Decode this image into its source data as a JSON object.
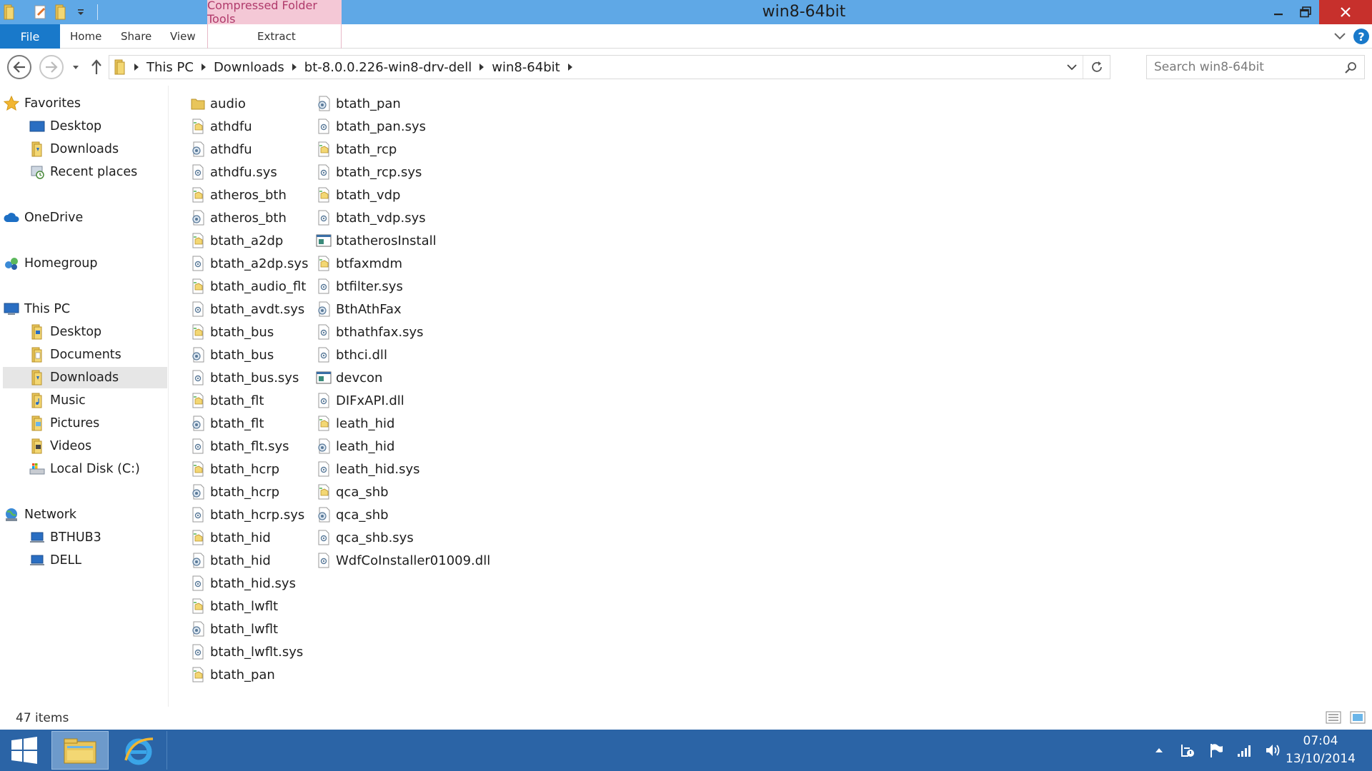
{
  "window": {
    "title": "win8-64bit",
    "context_group": "Compressed Folder Tools"
  },
  "ribbon": {
    "tabs": [
      {
        "label": "File"
      },
      {
        "label": "Home"
      },
      {
        "label": "Share"
      },
      {
        "label": "View"
      },
      {
        "label": "Extract"
      }
    ]
  },
  "address": {
    "crumbs": [
      "This PC",
      "Downloads",
      "bt-8.0.0.226-win8-drv-dell",
      "win8-64bit"
    ],
    "search_placeholder": "Search win8-64bit"
  },
  "nav": {
    "items": [
      {
        "label": "Favorites",
        "icon": "star-icon"
      },
      {
        "label": "Desktop",
        "icon": "desktop-icon"
      },
      {
        "label": "Downloads",
        "icon": "downloads-folder-icon"
      },
      {
        "label": "Recent places",
        "icon": "recent-places-icon"
      },
      {
        "label": "OneDrive",
        "icon": "cloud-icon"
      },
      {
        "label": "Homegroup",
        "icon": "homegroup-icon"
      },
      {
        "label": "This PC",
        "icon": "computer-icon"
      },
      {
        "label": "Desktop",
        "icon": "desktop-folder-icon"
      },
      {
        "label": "Documents",
        "icon": "documents-folder-icon"
      },
      {
        "label": "Downloads",
        "icon": "downloads-folder-icon"
      },
      {
        "label": "Music",
        "icon": "music-folder-icon"
      },
      {
        "label": "Pictures",
        "icon": "pictures-folder-icon"
      },
      {
        "label": "Videos",
        "icon": "videos-folder-icon"
      },
      {
        "label": "Local Disk (C:)",
        "icon": "drive-icon"
      },
      {
        "label": "Network",
        "icon": "network-icon"
      },
      {
        "label": "BTHUB3",
        "icon": "network-computer-icon"
      },
      {
        "label": "DELL",
        "icon": "network-computer-icon"
      }
    ],
    "selected": "Downloads"
  },
  "files": {
    "items": [
      {
        "name": "audio",
        "icon": "folder-icon"
      },
      {
        "name": "athdfu",
        "icon": "setup-info-icon"
      },
      {
        "name": "athdfu",
        "icon": "security-catalog-icon"
      },
      {
        "name": "athdfu.sys",
        "icon": "system-file-icon"
      },
      {
        "name": "atheros_bth",
        "icon": "setup-info-icon"
      },
      {
        "name": "atheros_bth",
        "icon": "security-catalog-icon"
      },
      {
        "name": "btath_a2dp",
        "icon": "setup-info-icon"
      },
      {
        "name": "btath_a2dp.sys",
        "icon": "system-file-icon"
      },
      {
        "name": "btath_audio_flt",
        "icon": "setup-info-icon"
      },
      {
        "name": "btath_avdt.sys",
        "icon": "system-file-icon"
      },
      {
        "name": "btath_bus",
        "icon": "setup-info-icon"
      },
      {
        "name": "btath_bus",
        "icon": "security-catalog-icon"
      },
      {
        "name": "btath_bus.sys",
        "icon": "system-file-icon"
      },
      {
        "name": "btath_flt",
        "icon": "setup-info-icon"
      },
      {
        "name": "btath_flt",
        "icon": "security-catalog-icon"
      },
      {
        "name": "btath_flt.sys",
        "icon": "system-file-icon"
      },
      {
        "name": "btath_hcrp",
        "icon": "setup-info-icon"
      },
      {
        "name": "btath_hcrp",
        "icon": "security-catalog-icon"
      },
      {
        "name": "btath_hcrp.sys",
        "icon": "system-file-icon"
      },
      {
        "name": "btath_hid",
        "icon": "setup-info-icon"
      },
      {
        "name": "btath_hid",
        "icon": "security-catalog-icon"
      },
      {
        "name": "btath_hid.sys",
        "icon": "system-file-icon"
      },
      {
        "name": "btath_lwflt",
        "icon": "setup-info-icon"
      },
      {
        "name": "btath_lwflt",
        "icon": "security-catalog-icon"
      },
      {
        "name": "btath_lwflt.sys",
        "icon": "system-file-icon"
      },
      {
        "name": "btath_pan",
        "icon": "setup-info-icon"
      },
      {
        "name": "btath_pan",
        "icon": "security-catalog-icon"
      },
      {
        "name": "btath_pan.sys",
        "icon": "system-file-icon"
      },
      {
        "name": "btath_rcp",
        "icon": "setup-info-icon"
      },
      {
        "name": "btath_rcp.sys",
        "icon": "system-file-icon"
      },
      {
        "name": "btath_vdp",
        "icon": "setup-info-icon"
      },
      {
        "name": "btath_vdp.sys",
        "icon": "system-file-icon"
      },
      {
        "name": "btatherosInstall",
        "icon": "application-icon"
      },
      {
        "name": "btfaxmdm",
        "icon": "setup-info-icon"
      },
      {
        "name": "btfilter.sys",
        "icon": "system-file-icon"
      },
      {
        "name": "BthAthFax",
        "icon": "security-catalog-icon"
      },
      {
        "name": "bthathfax.sys",
        "icon": "system-file-icon"
      },
      {
        "name": "bthci.dll",
        "icon": "system-file-icon"
      },
      {
        "name": "devcon",
        "icon": "application-icon"
      },
      {
        "name": "DIFxAPI.dll",
        "icon": "system-file-icon"
      },
      {
        "name": "leath_hid",
        "icon": "setup-info-icon"
      },
      {
        "name": "leath_hid",
        "icon": "security-catalog-icon"
      },
      {
        "name": "leath_hid.sys",
        "icon": "system-file-icon"
      },
      {
        "name": "qca_shb",
        "icon": "setup-info-icon"
      },
      {
        "name": "qca_shb",
        "icon": "security-catalog-icon"
      },
      {
        "name": "qca_shb.sys",
        "icon": "system-file-icon"
      },
      {
        "name": "WdfCoInstaller01009.dll",
        "icon": "system-file-icon"
      }
    ]
  },
  "status": {
    "items_count": "47 items"
  },
  "taskbar": {
    "clock_time": "07:04",
    "clock_date": "13/10/2014"
  },
  "colors": {
    "titlebar": "#5fa8e6",
    "file_tab": "#1979ca",
    "context_tab": "#f4c8d6",
    "close_button": "#c7302c",
    "taskbar": "#2b64a6",
    "selection": "#e6e6e6"
  }
}
